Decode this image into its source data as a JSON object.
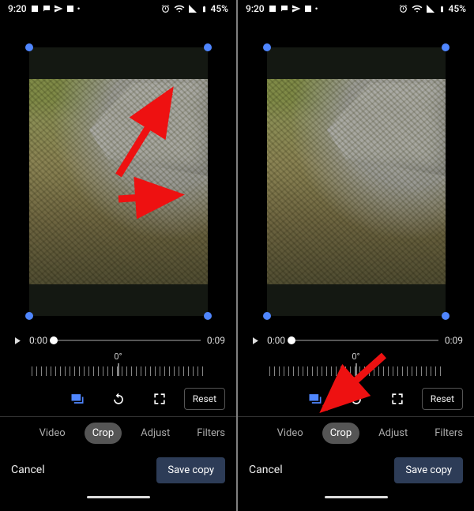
{
  "status": {
    "time": "9:20",
    "battery": "45%",
    "icons_left": [
      "square-icon",
      "chat-icon",
      "send-icon",
      "image-icon",
      "dots-icon"
    ],
    "icons_right": [
      "alarm-icon",
      "wifi-icon",
      "signal-icon",
      "battery-icon"
    ]
  },
  "playback": {
    "current": "0:00",
    "duration": "0:09"
  },
  "rotation": {
    "angle_label": "0°"
  },
  "tools": {
    "aspect_icon": "aspect-icon",
    "rotate_icon": "rotate-icon",
    "transform_icon": "transform-icon",
    "reset_label": "Reset"
  },
  "tabs": {
    "items": [
      "Video",
      "Crop",
      "Adjust",
      "Filters"
    ],
    "active_index": 1
  },
  "actions": {
    "cancel": "Cancel",
    "save": "Save copy"
  },
  "annotations": {
    "left": "Drag corner handles to adjust crop",
    "right": "Tap aspect-ratio tool"
  }
}
